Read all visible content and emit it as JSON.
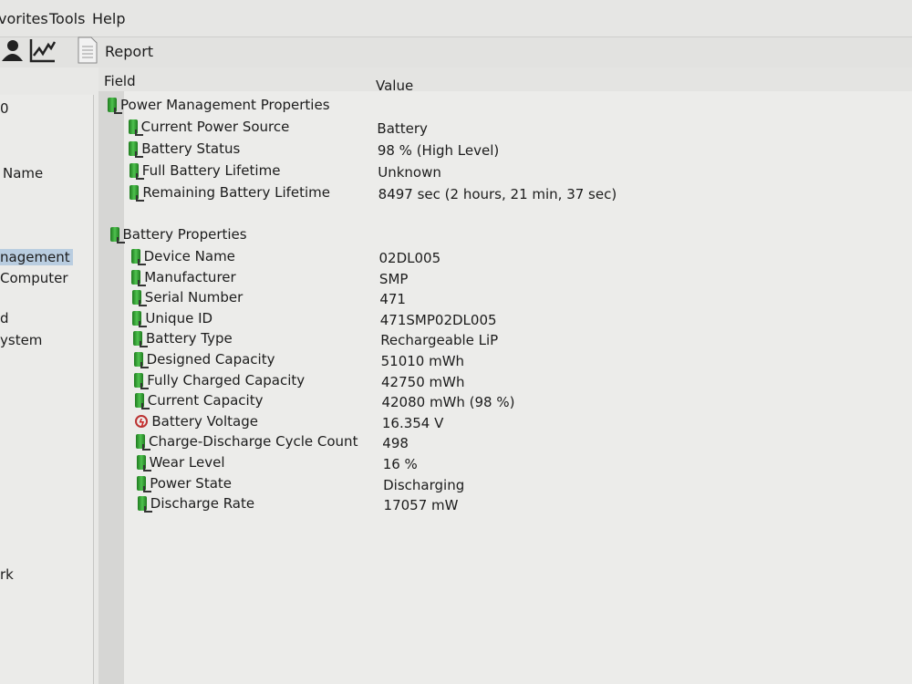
{
  "menu": [
    "vorites",
    "Tools",
    "Help"
  ],
  "toolbar": {
    "report_label": "Report"
  },
  "sidebar": {
    "items": [
      "0",
      "Name",
      "nagement",
      "Computer",
      "d",
      "ystem",
      "rk"
    ],
    "selected": "nagement"
  },
  "table": {
    "headers": {
      "field": "Field",
      "value": "Value"
    },
    "groups": [
      {
        "title": "Power Management Properties",
        "rows": [
          {
            "field": "Current Power Source",
            "value": "Battery",
            "icon": "battery-icon"
          },
          {
            "field": "Battery Status",
            "value": "98 % (High Level)",
            "icon": "battery-icon"
          },
          {
            "field": "Full Battery Lifetime",
            "value": "Unknown",
            "icon": "battery-icon"
          },
          {
            "field": "Remaining Battery Lifetime",
            "value": "8497 sec (2 hours, 21 min, 37 sec)",
            "icon": "battery-icon"
          }
        ]
      },
      {
        "title": "Battery Properties",
        "rows": [
          {
            "field": "Device Name",
            "value": "02DL005",
            "icon": "battery-icon"
          },
          {
            "field": "Manufacturer",
            "value": "SMP",
            "icon": "battery-icon"
          },
          {
            "field": "Serial Number",
            "value": "471",
            "icon": "battery-icon"
          },
          {
            "field": "Unique ID",
            "value": "471SMP02DL005",
            "icon": "battery-icon"
          },
          {
            "field": "Battery Type",
            "value": "Rechargeable LiP",
            "icon": "battery-icon"
          },
          {
            "field": "Designed Capacity",
            "value": "51010 mWh",
            "icon": "battery-icon"
          },
          {
            "field": "Fully Charged Capacity",
            "value": "42750 mWh",
            "icon": "battery-icon"
          },
          {
            "field": "Current Capacity",
            "value": "42080 mWh  (98 %)",
            "icon": "battery-icon"
          },
          {
            "field": "Battery Voltage",
            "value": "16.354 V",
            "icon": "voltage-icon"
          },
          {
            "field": "Charge-Discharge Cycle Count",
            "value": "498",
            "icon": "battery-icon"
          },
          {
            "field": "Wear Level",
            "value": "16 %",
            "icon": "battery-icon"
          },
          {
            "field": "Power State",
            "value": "Discharging",
            "icon": "battery-icon"
          },
          {
            "field": "Discharge Rate",
            "value": "17057 mW",
            "icon": "battery-icon"
          }
        ]
      }
    ]
  }
}
